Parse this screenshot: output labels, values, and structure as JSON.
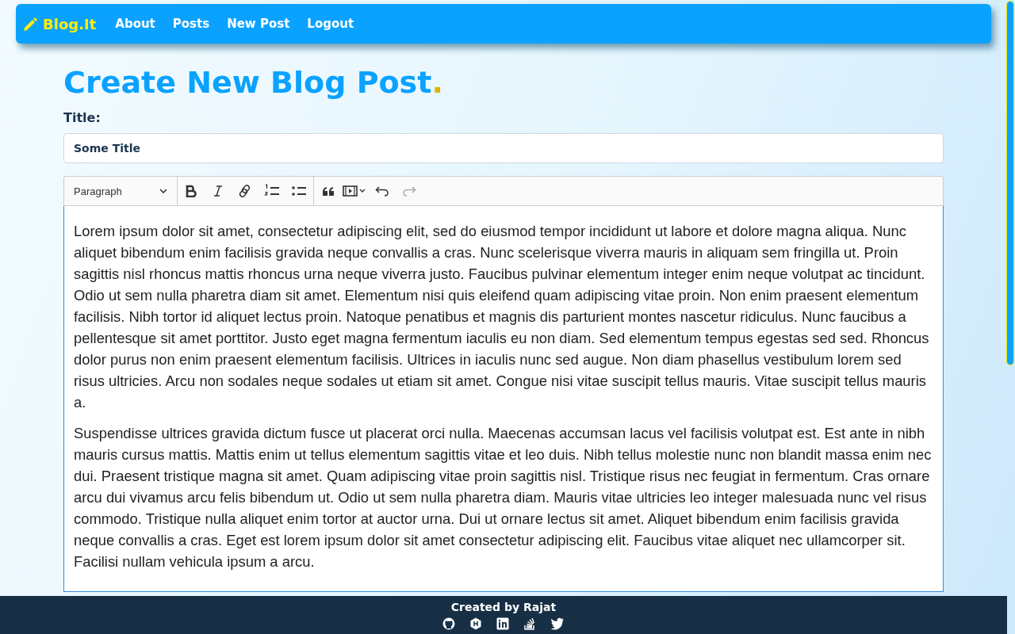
{
  "navbar": {
    "brand": "Blog.It",
    "links": [
      {
        "label": "About"
      },
      {
        "label": "Posts"
      },
      {
        "label": "New Post"
      },
      {
        "label": "Logout"
      }
    ]
  },
  "heading": {
    "text": "Create New Blog Post",
    "dot": "."
  },
  "title_field": {
    "label": "Title:",
    "value": "Some Title"
  },
  "editor": {
    "block_format": "Paragraph",
    "tool_groups": [
      [
        {
          "kind": "bold",
          "disabled": false
        },
        {
          "kind": "italic",
          "disabled": false
        },
        {
          "kind": "link",
          "disabled": false
        },
        {
          "kind": "numbered-list",
          "disabled": false
        },
        {
          "kind": "bulleted-list",
          "disabled": false
        }
      ],
      [
        {
          "kind": "quote",
          "disabled": false
        },
        {
          "kind": "media",
          "disabled": false
        },
        {
          "kind": "undo",
          "disabled": false
        },
        {
          "kind": "redo",
          "disabled": true
        }
      ]
    ],
    "paragraphs": [
      "Lorem ipsum dolor sit amet, consectetur adipiscing elit, sed do eiusmod tempor incididunt ut labore et dolore magna aliqua. Nunc aliquet bibendum enim facilisis gravida neque convallis a cras. Nunc scelerisque viverra mauris in aliquam sem fringilla ut. Proin sagittis nisl rhoncus mattis rhoncus urna neque viverra justo. Faucibus pulvinar elementum integer enim neque volutpat ac tincidunt. Odio ut sem nulla pharetra diam sit amet. Elementum nisi quis eleifend quam adipiscing vitae proin. Non enim praesent elementum facilisis. Nibh tortor id aliquet lectus proin. Natoque penatibus et magnis dis parturient montes nascetur ridiculus. Nunc faucibus a pellentesque sit amet porttitor. Justo eget magna fermentum iaculis eu non diam. Sed elementum tempus egestas sed sed. Rhoncus dolor purus non enim praesent elementum facilisis. Ultrices in iaculis nunc sed augue. Non diam phasellus vestibulum lorem sed risus ultricies. Arcu non sodales neque sodales ut etiam sit amet. Congue nisi vitae suscipit tellus mauris. Vitae suscipit tellus mauris a.",
      "Suspendisse ultrices gravida dictum fusce ut placerat orci nulla. Maecenas accumsan lacus vel facilisis volutpat est. Est ante in nibh mauris cursus mattis. Mattis enim ut tellus elementum sagittis vitae et leo duis. Nibh tellus molestie nunc non blandit massa enim nec dui. Praesent tristique magna sit amet. Quam adipiscing vitae proin sagittis nisl. Tristique risus nec feugiat in fermentum. Cras ornare arcu dui vivamus arcu felis bibendum ut. Odio ut sem nulla pharetra diam. Mauris vitae ultricies leo integer malesuada nunc vel risus commodo. Tristique nulla aliquet enim tortor at auctor urna. Dui ut ornare lectus sit amet. Aliquet bibendum enim facilisis gravida neque convallis a cras. Eget est lorem ipsum dolor sit amet consectetur adipiscing elit. Faucibus vitae aliquet nec ullamcorper sit. Facilisi nullam vehicula ipsum a arcu."
    ]
  },
  "footer": {
    "credit": "Created by Rajat",
    "icons": [
      {
        "kind": "github"
      },
      {
        "kind": "hashnode"
      },
      {
        "kind": "linkedin"
      },
      {
        "kind": "stackoverflow"
      },
      {
        "kind": "twitter"
      }
    ]
  }
}
